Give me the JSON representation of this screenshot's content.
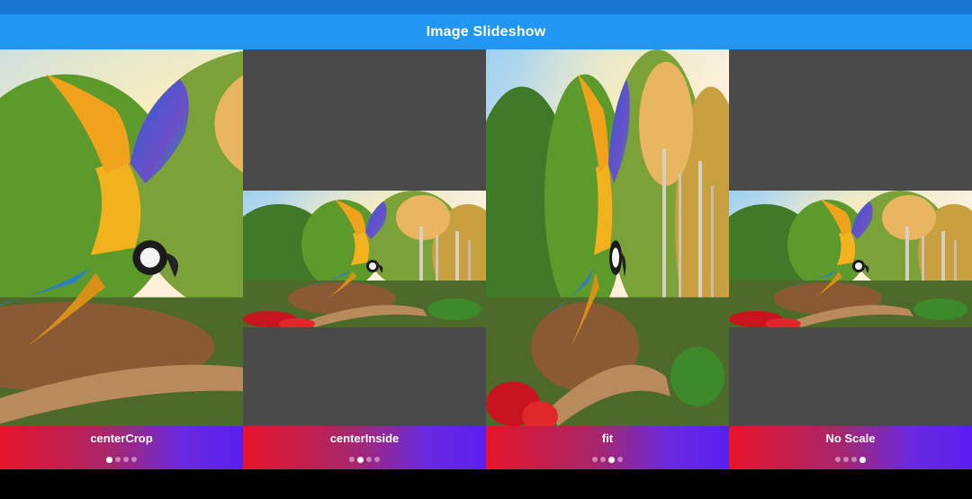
{
  "app": {
    "title": "Image Slideshow"
  },
  "colors": {
    "status_bar": "#1976D2",
    "app_bar": "#2196F3",
    "letterbox": "#4a4a4a",
    "caption_gradient_start": "#e8142a",
    "caption_gradient_end": "#5a1ff0"
  },
  "slides": [
    {
      "label": "centerCrop",
      "active_dot": 0,
      "dot_count": 4
    },
    {
      "label": "centerInside",
      "active_dot": 1,
      "dot_count": 4
    },
    {
      "label": "fit",
      "active_dot": 2,
      "dot_count": 4
    },
    {
      "label": "No Scale",
      "active_dot": 3,
      "dot_count": 4
    }
  ]
}
